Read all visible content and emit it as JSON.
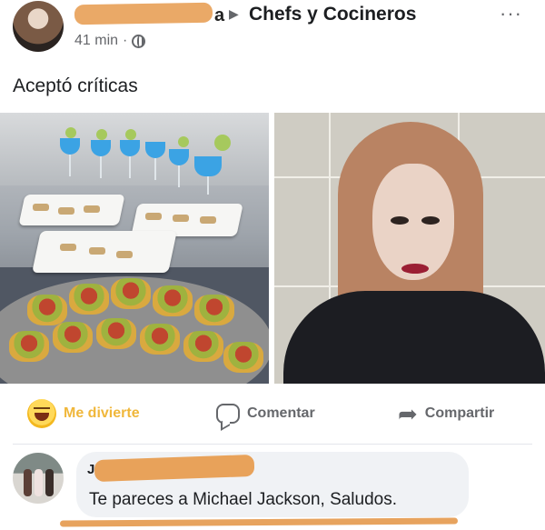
{
  "post": {
    "author_tail": "a",
    "group_name": "Chefs y Cocineros",
    "time": "41 min",
    "separator": "·",
    "more_label": "···",
    "text": "Aceptó críticas"
  },
  "actions": {
    "reaction_label": "Me divierte",
    "comment_label": "Comentar",
    "share_label": "Compartir"
  },
  "comment": {
    "author_initial": "J",
    "text": "Te pareces a Michael Jackson, Saludos."
  },
  "colors": {
    "redaction": "#e8a25a",
    "reaction_yellow": "#f0b73b",
    "muted_text": "#65676b",
    "bubble_bg": "#f0f2f5"
  }
}
